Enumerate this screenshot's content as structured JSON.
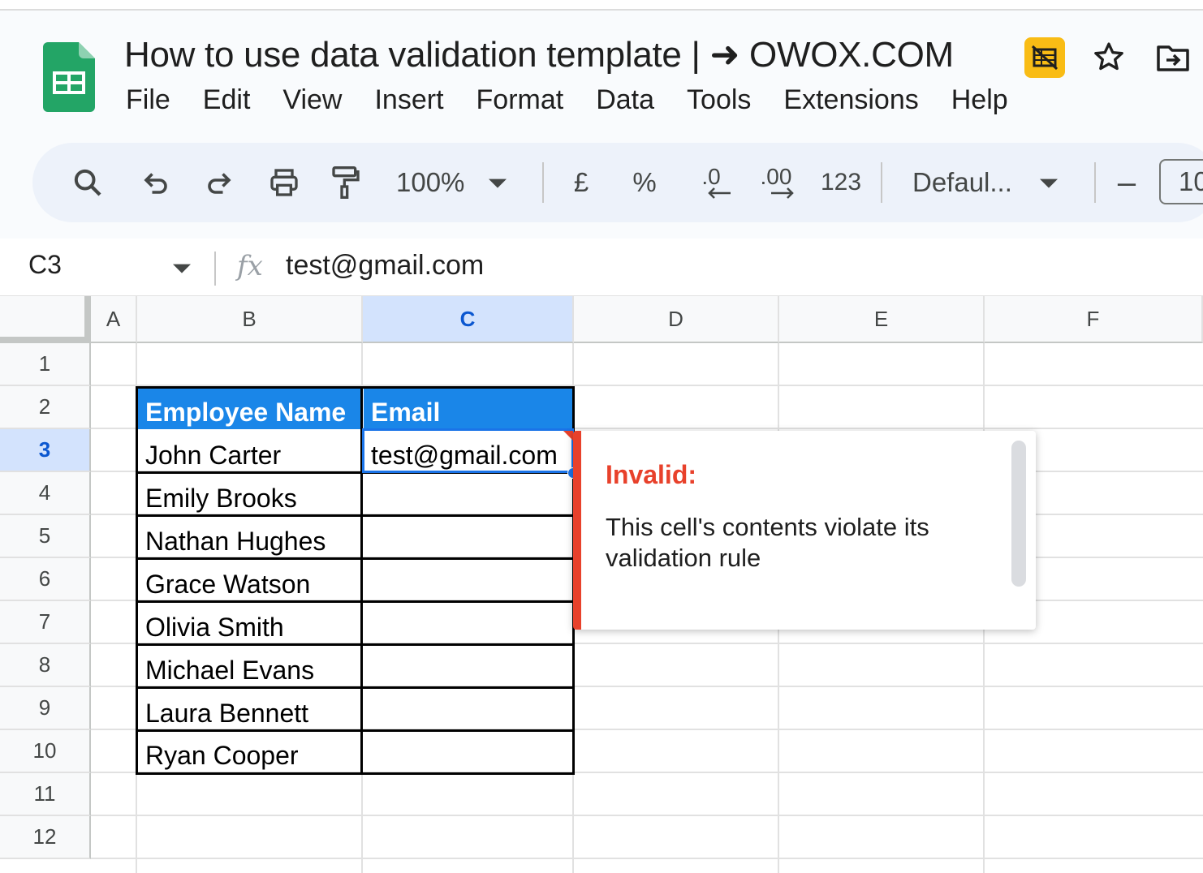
{
  "app": {
    "title": "How to use data validation template | ➜ OWOX.COM",
    "menu": [
      "File",
      "Edit",
      "View",
      "Insert",
      "Format",
      "Data",
      "Tools",
      "Extensions",
      "Help"
    ],
    "header_icons": [
      "sheets-logo-icon",
      "hide-icon",
      "star-icon",
      "move-to-folder-icon"
    ],
    "accent_color": "#f9bc15"
  },
  "toolbar": {
    "zoom": "100%",
    "currency": "£",
    "percent": "%",
    "decrease_decimal": ".0",
    "increase_decimal": ".00",
    "number_format": "123",
    "font": "Defaul...",
    "font_size": "10",
    "minus": "–"
  },
  "formula_bar": {
    "cell_ref": "C3",
    "fx": "fx",
    "value": "test@gmail.com"
  },
  "sheet": {
    "columns": [
      "A",
      "B",
      "C",
      "D",
      "E",
      "F"
    ],
    "rows": [
      "1",
      "2",
      "3",
      "4",
      "5",
      "6",
      "7",
      "8",
      "9",
      "10",
      "11",
      "12"
    ],
    "selected_column": "C",
    "selected_row": "3",
    "table": {
      "headers": [
        "Employee Name",
        "Email"
      ],
      "rows": [
        [
          "John Carter",
          "test@gmail.com"
        ],
        [
          "Emily Brooks",
          ""
        ],
        [
          "Nathan Hughes",
          ""
        ],
        [
          "Grace Watson",
          ""
        ],
        [
          "Olivia Smith",
          ""
        ],
        [
          "Michael Evans",
          ""
        ],
        [
          "Laura Bennett",
          ""
        ],
        [
          "Ryan Cooper",
          ""
        ]
      ],
      "header_color": "#1a86e8"
    }
  },
  "validation_tooltip": {
    "title": "Invalid:",
    "message": "This cell's contents violate its validation rule",
    "color": "#e8412b"
  }
}
